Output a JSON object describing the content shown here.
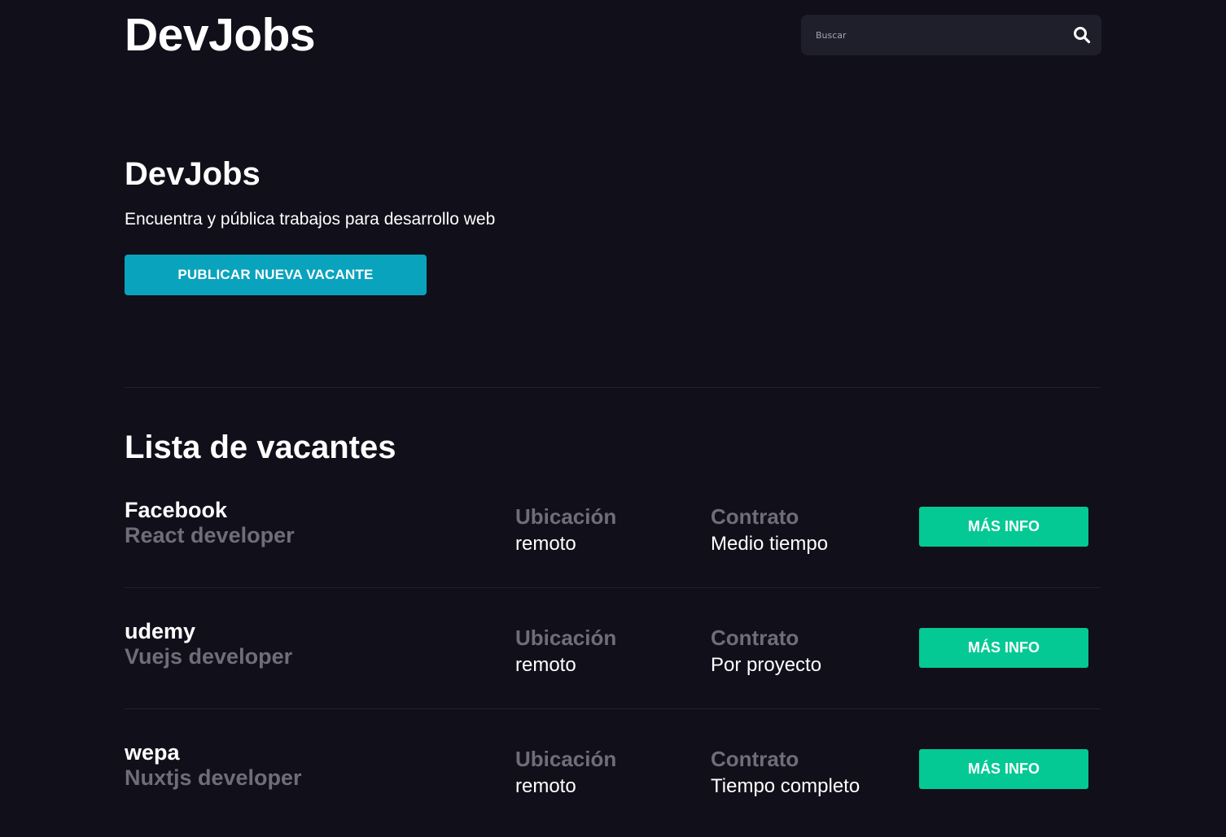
{
  "header": {
    "logo": "DevJobs",
    "search_placeholder": "Buscar"
  },
  "hero": {
    "title": "DevJobs",
    "subtitle": "Encuentra y pública trabajos para desarrollo web",
    "publish_button": "PUBLICAR NUEVA VACANTE"
  },
  "list": {
    "title": "Lista de vacantes",
    "location_label": "Ubicación",
    "contract_label": "Contrato",
    "more_info_label": "MÁS INFO",
    "jobs": [
      {
        "company": "Facebook",
        "position": "React developer",
        "location": "remoto",
        "contract": "Medio tiempo"
      },
      {
        "company": "udemy",
        "position": "Vuejs developer",
        "location": "remoto",
        "contract": "Por proyecto"
      },
      {
        "company": "wepa",
        "position": "Nuxtjs developer",
        "location": "remoto",
        "contract": "Tiempo completo"
      }
    ]
  },
  "colors": {
    "background": "#100f1a",
    "primary_button": "#0aa3bd",
    "info_button": "#04c994",
    "muted_text": "#6f6e78",
    "search_bg": "#1f1e2b"
  }
}
